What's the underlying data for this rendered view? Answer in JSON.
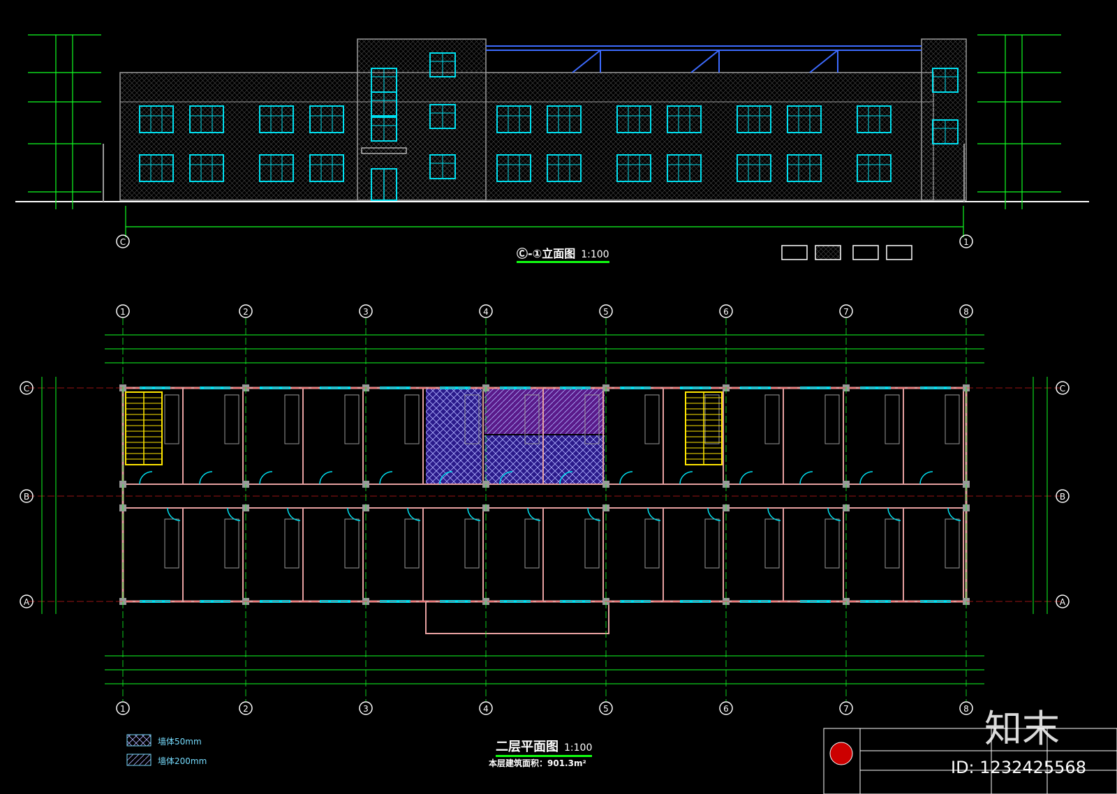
{
  "elevation": {
    "title": "Ⓒ-①立面图",
    "scale": "1:100",
    "axis_left": "C",
    "axis_right": "1"
  },
  "plan": {
    "title": "二层平面图",
    "scale": "1:100",
    "area_note": "本层建筑面积：901.3m²",
    "columns": [
      "1",
      "2",
      "3",
      "4",
      "5",
      "6",
      "7",
      "8"
    ],
    "rows": [
      "C",
      "B",
      "A"
    ],
    "legend": [
      {
        "label": "墙体50mm"
      },
      {
        "label": "墙体200mm"
      }
    ]
  },
  "colors": {
    "green": "#11ff22",
    "cyan": "#00e0f0",
    "yellow": "#ffe600",
    "blue": "#3d6bff",
    "red": "#ff2020",
    "grey": "#9a9a9a",
    "pink": "#e6a0a0",
    "purple": "#9a3dff",
    "white": "#ffffff"
  },
  "watermark": {
    "brand": "知末",
    "id": "ID: 1232425568"
  }
}
